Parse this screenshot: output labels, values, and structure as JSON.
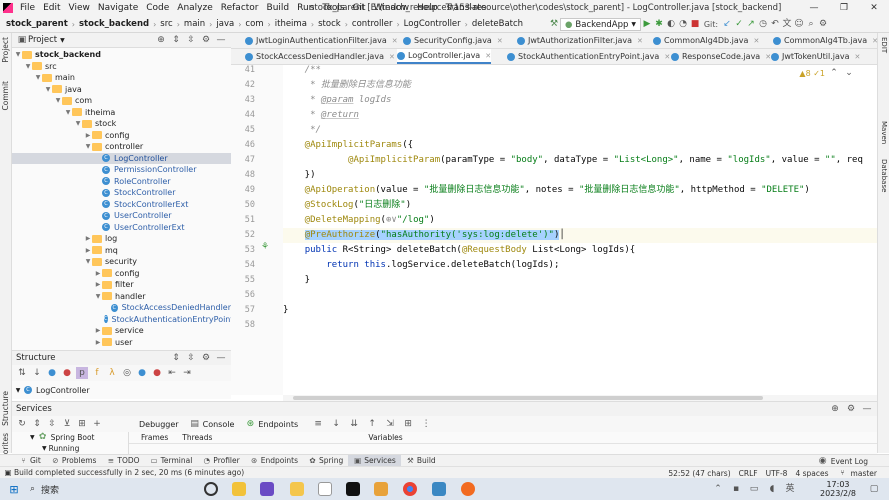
{
  "menubar": {
    "items": [
      "File",
      "Edit",
      "View",
      "Navigate",
      "Code",
      "Analyze",
      "Refactor",
      "Build",
      "Run",
      "Tools",
      "Git",
      "Window",
      "Help",
      "Translate"
    ],
    "window_title": "stock_parent [E:\\teach_resources\\153-resource\\other\\codes\\stock_parent] - LogController.java [stock_backend]",
    "controls": [
      "—",
      "❐",
      "✕"
    ]
  },
  "navbar": {
    "breadcrumbs": [
      "stock_parent",
      "stock_backend",
      "src",
      "main",
      "java",
      "com",
      "itheima",
      "stock",
      "controller",
      "LogController",
      "deleteBatch"
    ],
    "run_config": "BackendApp",
    "git_label": "Git:"
  },
  "left_strip": [
    "Project",
    "Commit",
    "Structure",
    "Favorites"
  ],
  "right_strip": [
    "EDIT",
    "Maven",
    "Database"
  ],
  "project_panel": {
    "title": "Project",
    "tree": [
      {
        "label": "stock_backend",
        "depth": 1,
        "kind": "folder",
        "open": true,
        "bold": true
      },
      {
        "label": "src",
        "depth": 2,
        "kind": "folder",
        "open": true
      },
      {
        "label": "main",
        "depth": 3,
        "kind": "folder",
        "open": true
      },
      {
        "label": "java",
        "depth": 4,
        "kind": "folder",
        "open": true
      },
      {
        "label": "com",
        "depth": 5,
        "kind": "folder",
        "open": true
      },
      {
        "label": "itheima",
        "depth": 6,
        "kind": "folder",
        "open": true
      },
      {
        "label": "stock",
        "depth": 7,
        "kind": "folder",
        "open": true
      },
      {
        "label": "config",
        "depth": 8,
        "kind": "folder",
        "open": false
      },
      {
        "label": "controller",
        "depth": 8,
        "kind": "folder",
        "open": true
      },
      {
        "label": "LogController",
        "depth": 9,
        "kind": "class",
        "selected": true
      },
      {
        "label": "PermissionController",
        "depth": 9,
        "kind": "class"
      },
      {
        "label": "RoleController",
        "depth": 9,
        "kind": "class"
      },
      {
        "label": "StockController",
        "depth": 9,
        "kind": "class"
      },
      {
        "label": "StockControllerExt",
        "depth": 9,
        "kind": "class"
      },
      {
        "label": "UserController",
        "depth": 9,
        "kind": "class"
      },
      {
        "label": "UserControllerExt",
        "depth": 9,
        "kind": "class"
      },
      {
        "label": "log",
        "depth": 8,
        "kind": "folder",
        "open": false
      },
      {
        "label": "mq",
        "depth": 8,
        "kind": "folder",
        "open": false
      },
      {
        "label": "security",
        "depth": 8,
        "kind": "folder",
        "open": true
      },
      {
        "label": "config",
        "depth": 9,
        "kind": "folder",
        "open": false
      },
      {
        "label": "filter",
        "depth": 9,
        "kind": "folder",
        "open": false
      },
      {
        "label": "handler",
        "depth": 9,
        "kind": "folder",
        "open": true
      },
      {
        "label": "StockAccessDeniedHandler",
        "depth": 10,
        "kind": "class"
      },
      {
        "label": "StockAuthenticationEntryPoint",
        "depth": 10,
        "kind": "class"
      },
      {
        "label": "service",
        "depth": 9,
        "kind": "folder",
        "open": false
      },
      {
        "label": "user",
        "depth": 9,
        "kind": "folder",
        "open": false
      }
    ]
  },
  "structure_panel": {
    "title": "Structure",
    "root": "LogController"
  },
  "editor_tabs_row1": [
    {
      "label": "JwtLoginAuthenticationFilter.java",
      "kind": "class"
    },
    {
      "label": "SecurityConfig.java",
      "kind": "class"
    },
    {
      "label": "JwtAuthorizationFilter.java",
      "kind": "class"
    },
    {
      "label": "CommonAlg4Db.java",
      "kind": "class"
    },
    {
      "label": "CommonAlg4Tb.java",
      "kind": "class"
    }
  ],
  "editor_tabs_row2": [
    {
      "label": "StockAccessDeniedHandler.java",
      "kind": "class"
    },
    {
      "label": "LogController.java",
      "kind": "class",
      "active": true
    },
    {
      "label": "StockAuthenticationEntryPoint.java",
      "kind": "class"
    },
    {
      "label": "ResponseCode.java",
      "kind": "class"
    },
    {
      "label": "JwtTokenUtil.java",
      "kind": "class"
    }
  ],
  "editor": {
    "inspection": "▲8 ✓1",
    "line_numbers": [
      "41",
      "42",
      "43",
      "44",
      "45",
      "46",
      "47",
      "48",
      "49",
      "50",
      "51",
      "52",
      "53",
      "54",
      "55",
      "56",
      "57",
      "58"
    ],
    "lines": [
      [
        {
          "t": "    /**",
          "c": "cm"
        }
      ],
      [
        {
          "t": "     * 批量删除日志信息功能",
          "c": "cm"
        }
      ],
      [
        {
          "t": "     * ",
          "c": "cm"
        },
        {
          "t": "@param",
          "c": "ct"
        },
        {
          "t": " ",
          "c": "cm"
        },
        {
          "t": "logIds",
          "c": "cm"
        }
      ],
      [
        {
          "t": "     * ",
          "c": "cm"
        },
        {
          "t": "@return",
          "c": "ct"
        }
      ],
      [
        {
          "t": "     */",
          "c": "cm"
        }
      ],
      [
        {
          "t": "    @ApiImplicitParams",
          "c": "an"
        },
        {
          "t": "({",
          "c": ""
        }
      ],
      [
        {
          "t": "            @ApiImplicitParam",
          "c": "an"
        },
        {
          "t": "(paramType = ",
          "c": ""
        },
        {
          "t": "\"body\"",
          "c": "st"
        },
        {
          "t": ", dataType = ",
          "c": ""
        },
        {
          "t": "\"List<Long>\"",
          "c": "st"
        },
        {
          "t": ", name = ",
          "c": ""
        },
        {
          "t": "\"logIds\"",
          "c": "st"
        },
        {
          "t": ", value = ",
          "c": ""
        },
        {
          "t": "\"\"",
          "c": "st"
        },
        {
          "t": ", req",
          "c": ""
        }
      ],
      [
        {
          "t": "    })",
          "c": ""
        }
      ],
      [
        {
          "t": "    @ApiOperation",
          "c": "an"
        },
        {
          "t": "(value = ",
          "c": ""
        },
        {
          "t": "\"批量删除日志信息功能\"",
          "c": "st"
        },
        {
          "t": ", notes = ",
          "c": ""
        },
        {
          "t": "\"批量删除日志信息功能\"",
          "c": "st"
        },
        {
          "t": ", httpMethod = ",
          "c": ""
        },
        {
          "t": "\"DELETE\"",
          "c": "st"
        },
        {
          "t": ")",
          "c": ""
        }
      ],
      [
        {
          "t": "    @StockLog",
          "c": "an"
        },
        {
          "t": "(",
          "c": ""
        },
        {
          "t": "\"日志删除\"",
          "c": "st"
        },
        {
          "t": ")",
          "c": ""
        }
      ],
      [
        {
          "t": "    @DeleteMapping",
          "c": "an"
        },
        {
          "t": "(",
          "c": ""
        },
        {
          "t": "⊕∨",
          "c": "cm"
        },
        {
          "t": "\"/log\"",
          "c": "st"
        },
        {
          "t": ")",
          "c": ""
        }
      ],
      [
        {
          "t": "    ",
          "c": ""
        },
        {
          "t": "@PreAuthorize",
          "c": "an sel2"
        },
        {
          "t": "(",
          "c": "sel2"
        },
        {
          "t": "\"hasAuthority('sys:log:delete')\"",
          "c": "st sel2"
        },
        {
          "t": ")",
          "c": "sel2"
        },
        {
          "t": "│",
          "c": ""
        }
      ],
      [
        {
          "t": "    ",
          "c": ""
        },
        {
          "t": "public",
          "c": "k"
        },
        {
          "t": " R<String> deleteBatch(",
          "c": ""
        },
        {
          "t": "@RequestBody",
          "c": "an"
        },
        {
          "t": " List<Long> logIds){",
          "c": ""
        }
      ],
      [
        {
          "t": "        ",
          "c": ""
        },
        {
          "t": "return",
          "c": "k"
        },
        {
          "t": " ",
          "c": ""
        },
        {
          "t": "this",
          "c": "k"
        },
        {
          "t": ".logService.deleteBatch(logIds);",
          "c": ""
        }
      ],
      [
        {
          "t": "    }",
          "c": ""
        }
      ],
      [
        {
          "t": "",
          "c": ""
        }
      ],
      [
        {
          "t": "}",
          "c": ""
        }
      ],
      [
        {
          "t": "",
          "c": ""
        }
      ]
    ]
  },
  "services_panel": {
    "title": "Services",
    "tabs": [
      "Debugger",
      "Console",
      "Endpoints"
    ],
    "sub_tabs": [
      "Frames",
      "Threads"
    ],
    "variables": "Variables",
    "tree": [
      "Spring Boot",
      "Running"
    ]
  },
  "tool_tabs": [
    "Git",
    "Problems",
    "TODO",
    "Terminal",
    "Profiler",
    "Endpoints",
    "Spring",
    "Services",
    "Build"
  ],
  "event_log": "Event Log",
  "status": {
    "message": "Build completed successfully in 2 sec, 20 ms (6 minutes ago)",
    "position": "52:52 (47 chars)",
    "line_ending": "CRLF",
    "encoding": "UTF-8",
    "indent": "4 spaces",
    "branch": "master"
  },
  "taskbar": {
    "search": "搜索",
    "time": "17:03",
    "date": "2023/2/8"
  }
}
